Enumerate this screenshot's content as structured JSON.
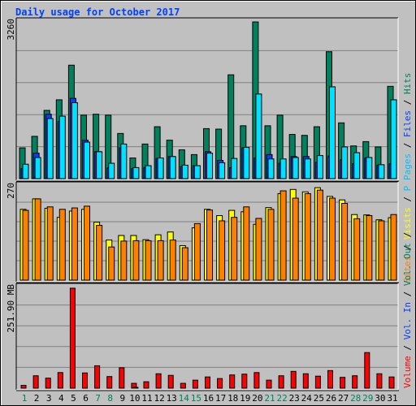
{
  "title": "Daily usage for October 2017",
  "chart_data": [
    {
      "type": "bar",
      "title": "Daily usage for October 2017",
      "panel": "hits-files-pages",
      "ymax_label": "3260",
      "ylim": [
        0,
        3260
      ],
      "grid": true,
      "categories": [
        "1",
        "2",
        "3",
        "4",
        "5",
        "6",
        "7",
        "8",
        "9",
        "10",
        "11",
        "12",
        "13",
        "14",
        "15",
        "16",
        "17",
        "18",
        "19",
        "20",
        "21",
        "22",
        "23",
        "24",
        "25",
        "26",
        "27",
        "28",
        "29",
        "30",
        "31"
      ],
      "weekend_days": [
        "1",
        "7",
        "8",
        "14",
        "15",
        "21",
        "22",
        "28",
        "29"
      ],
      "legend": [
        "Pages",
        "Files",
        "Hits"
      ],
      "legend_placement": "right",
      "series": [
        {
          "name": "Hits",
          "color": "#00805c",
          "values": [
            640,
            880,
            1420,
            1640,
            2360,
            1320,
            1340,
            1320,
            940,
            430,
            720,
            1080,
            800,
            600,
            500,
            1040,
            1030,
            2160,
            1100,
            3260,
            1100,
            1320,
            920,
            900,
            1080,
            2640,
            1160,
            680,
            770,
            660,
            1920
          ]
        },
        {
          "name": "Files",
          "color": "#0040ff",
          "values": [
            210,
            530,
            1340,
            1190,
            1670,
            800,
            560,
            220,
            640,
            210,
            230,
            420,
            460,
            250,
            270,
            560,
            380,
            230,
            640,
            430,
            500,
            320,
            460,
            460,
            340,
            470,
            390,
            310,
            430,
            280,
            310
          ]
        },
        {
          "name": "Pages",
          "color": "#00e0ff",
          "values": [
            300,
            440,
            1250,
            1300,
            1580,
            760,
            560,
            320,
            720,
            230,
            270,
            430,
            460,
            280,
            270,
            530,
            330,
            420,
            650,
            1760,
            410,
            410,
            440,
            410,
            480,
            1910,
            660,
            540,
            440,
            290,
            1640
          ]
        }
      ]
    },
    {
      "type": "bar",
      "panel": "visits-sites",
      "ymax_label": "270",
      "ylim": [
        0,
        270
      ],
      "grid": true,
      "categories": [
        "1",
        "2",
        "3",
        "4",
        "5",
        "6",
        "7",
        "8",
        "9",
        "10",
        "11",
        "12",
        "13",
        "14",
        "15",
        "16",
        "17",
        "18",
        "19",
        "20",
        "21",
        "22",
        "23",
        "24",
        "25",
        "26",
        "27",
        "28",
        "29",
        "30",
        "31"
      ],
      "legend": [
        "Sites",
        "Visits"
      ],
      "legend_placement": "right",
      "series": [
        {
          "name": "Visits",
          "color": "#ffff00",
          "values": [
            203,
            233,
            206,
            180,
            198,
            203,
            166,
            115,
            128,
            128,
            116,
            130,
            138,
            99,
            150,
            203,
            185,
            200,
            196,
            160,
            208,
            248,
            260,
            253,
            265,
            240,
            230,
            188,
            187,
            173,
            179
          ]
        },
        {
          "name": "Sites",
          "color": "#ff8000",
          "values": [
            200,
            233,
            210,
            203,
            207,
            212,
            157,
            95,
            112,
            113,
            113,
            113,
            115,
            93,
            162,
            201,
            170,
            180,
            210,
            177,
            203,
            256,
            235,
            248,
            258,
            235,
            220,
            176,
            185,
            170,
            188
          ]
        }
      ]
    },
    {
      "type": "bar",
      "panel": "volume",
      "ymax_label": "251.90 MB",
      "ylim": [
        0,
        251.9
      ],
      "grid": true,
      "categories": [
        "1",
        "2",
        "3",
        "4",
        "5",
        "6",
        "7",
        "8",
        "9",
        "10",
        "11",
        "12",
        "13",
        "14",
        "15",
        "16",
        "17",
        "18",
        "19",
        "20",
        "21",
        "22",
        "23",
        "24",
        "25",
        "26",
        "27",
        "28",
        "29",
        "30",
        "31"
      ],
      "legend": [
        "Volume",
        "Vol. In",
        "Vol. Out"
      ],
      "legend_placement": "right",
      "series": [
        {
          "name": "Volume",
          "color": "#ff0000",
          "values": [
            7,
            31,
            25,
            39,
            250,
            38,
            56,
            29,
            51,
            12,
            16,
            36,
            32,
            12,
            20,
            28,
            24,
            33,
            35,
            39,
            20,
            31,
            42,
            36,
            30,
            44,
            27,
            31,
            89,
            36,
            28
          ]
        },
        {
          "name": "Vol. In",
          "color": "#0040ff",
          "values": [
            0,
            0,
            0,
            0,
            0,
            0,
            0,
            0,
            0,
            2,
            0,
            0,
            0,
            0,
            0,
            0,
            0,
            0,
            0,
            0,
            0,
            0,
            0,
            0,
            0,
            0,
            0,
            0,
            0,
            0,
            0
          ]
        }
      ]
    }
  ],
  "legend_text": {
    "top": [
      {
        "t": "Pages",
        "c": "#00c0ff"
      },
      {
        "t": " / ",
        "c": "#000000"
      },
      {
        "t": "Files",
        "c": "#0040ff"
      },
      {
        "t": " / ",
        "c": "#000000"
      },
      {
        "t": "Hits",
        "c": "#00805c"
      }
    ],
    "middle": [
      {
        "t": "Sites",
        "c": "#ff8000"
      },
      {
        "t": " / ",
        "c": "#000000"
      },
      {
        "t": "Visits",
        "c": "#ffff00"
      },
      {
        "t": " / ",
        "c": "#000000"
      },
      {
        "t": "P",
        "c": "#00c0ff"
      }
    ],
    "bottom": [
      {
        "t": "Volume",
        "c": "#ff0000"
      },
      {
        "t": " / ",
        "c": "#000000"
      },
      {
        "t": "Vol. In",
        "c": "#0040ff"
      },
      {
        "t": " / ",
        "c": "#000000"
      },
      {
        "t": "Vol. Out",
        "c": "#00805c"
      },
      {
        "t": " / ",
        "c": "#000000"
      }
    ]
  },
  "colors": {
    "weekday": "#000000",
    "weekend": "#00805c",
    "title": "#0040ff"
  }
}
